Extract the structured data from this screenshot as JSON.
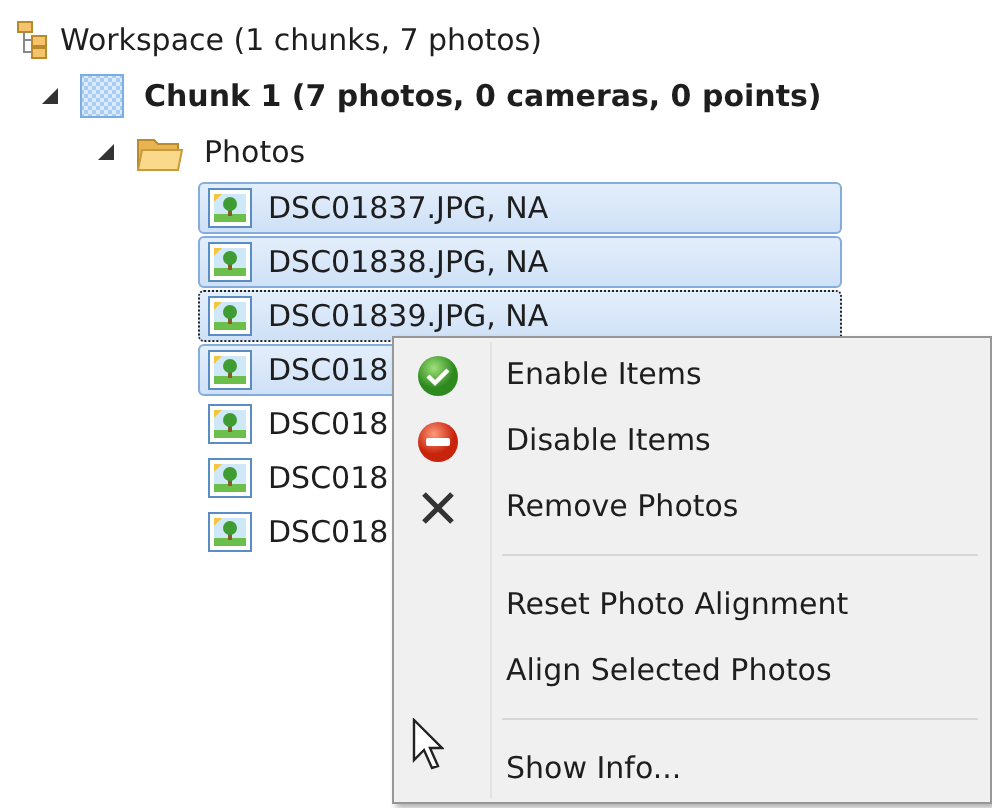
{
  "tree": {
    "label": "Workspace (1 chunks, 7 photos)",
    "children": [
      {
        "label": "Chunk 1 (7 photos, 0 cameras, 0 points)",
        "expanded": true,
        "children": [
          {
            "label": "Photos",
            "expanded": true,
            "children": [
              {
                "label": "DSC01837.JPG, NA",
                "kind": "photo",
                "selected": true,
                "focused": false
              },
              {
                "label": "DSC01838.JPG, NA",
                "kind": "photo",
                "selected": true,
                "focused": false
              },
              {
                "label": "DSC01839.JPG, NA",
                "kind": "photo",
                "selected": true,
                "focused": true
              },
              {
                "label": "DSC018",
                "kind": "photo",
                "selected": true,
                "focused": false
              },
              {
                "label": "DSC018",
                "kind": "photo",
                "selected": false,
                "focused": false
              },
              {
                "label": "DSC018",
                "kind": "photo",
                "selected": false,
                "focused": false
              },
              {
                "label": "DSC018",
                "kind": "photo",
                "selected": false,
                "focused": false
              }
            ]
          }
        ]
      }
    ]
  },
  "context_menu": {
    "items": [
      {
        "label": "Enable Items",
        "kind": "enable"
      },
      {
        "label": "Disable Items",
        "kind": "disable"
      },
      {
        "label": "Remove Photos",
        "kind": "remove"
      },
      {
        "kind": "separator"
      },
      {
        "label": "Reset Photo Alignment",
        "kind": "plain"
      },
      {
        "label": "Align Selected Photos",
        "kind": "plain"
      },
      {
        "kind": "separator"
      },
      {
        "label": "Show Info...",
        "kind": "plain"
      }
    ]
  }
}
